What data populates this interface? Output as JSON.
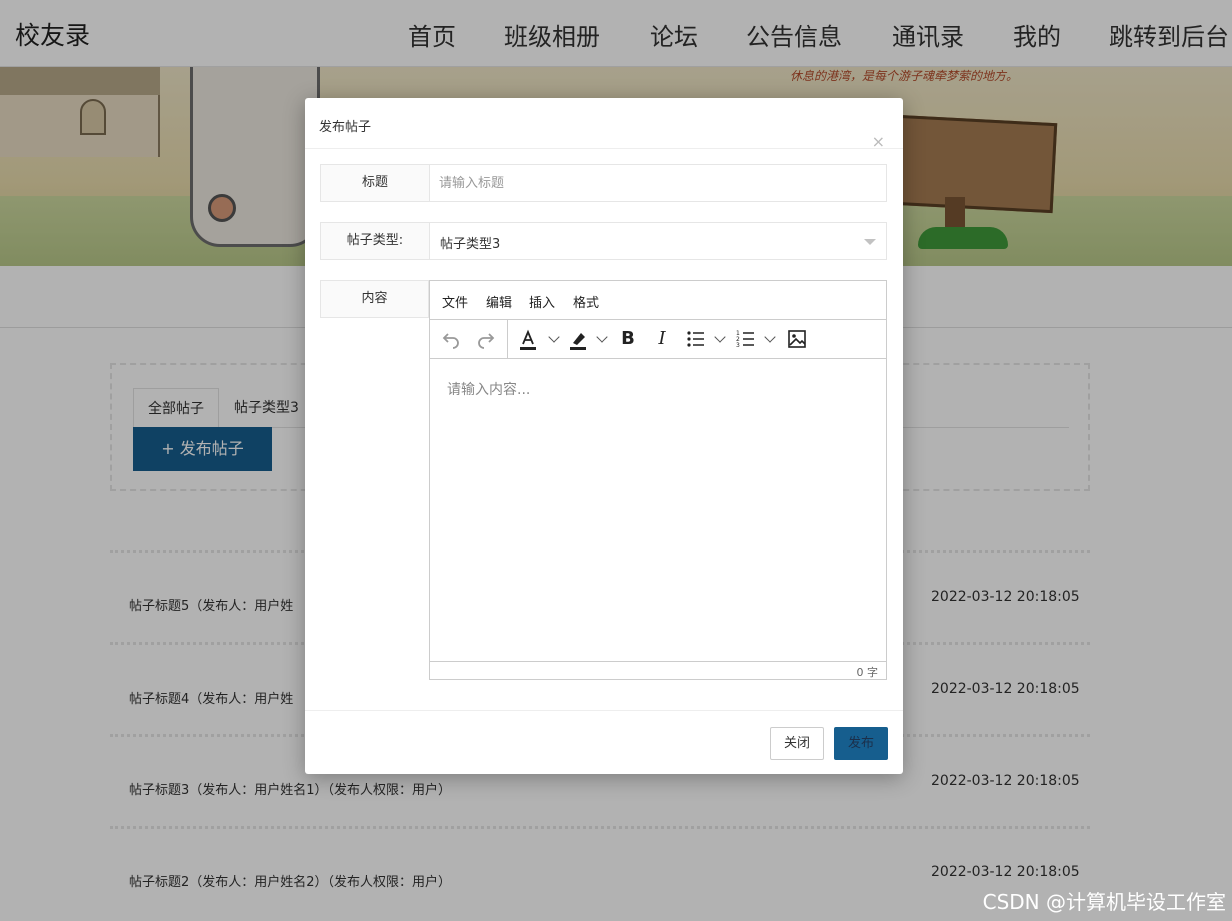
{
  "nav": {
    "brand": "校友录",
    "items": [
      "首页",
      "班级相册",
      "论坛",
      "公告信息",
      "通讯录",
      "我的",
      "跳转到后台"
    ]
  },
  "banner": {
    "slogan": "休息的港湾，是每个游子魂牵梦萦的地方。"
  },
  "forum": {
    "tabs": [
      "全部帖子",
      "帖子类型3"
    ],
    "publish_button": "+ 发布帖子",
    "posts": [
      {
        "title": "帖子标题5（发布人：用户姓",
        "time": "2022-03-12 20:18:05"
      },
      {
        "title": "帖子标题4（发布人：用户姓",
        "time": "2022-03-12 20:18:05"
      },
      {
        "title": "帖子标题3（发布人：用户姓名1）（发布人权限：用户）",
        "time": "2022-03-12 20:18:05"
      },
      {
        "title": "帖子标题2（发布人：用户姓名2）（发布人权限：用户）",
        "time": "2022-03-12 20:18:05"
      }
    ]
  },
  "modal": {
    "title": "发布帖子",
    "close_glyph": "×",
    "fields": {
      "title_label": "标题",
      "title_placeholder": "请输入标题",
      "type_label": "帖子类型:",
      "type_value": "帖子类型3",
      "content_label": "内容"
    },
    "editor": {
      "menus": [
        "文件",
        "编辑",
        "插入",
        "格式"
      ],
      "placeholder": "请输入内容...",
      "word_count": "0 字"
    },
    "buttons": {
      "close": "关闭",
      "submit": "发布"
    }
  },
  "watermark": "CSDN @计算机毕设工作室",
  "colors": {
    "primary": "#165e8e",
    "overlay": "rgba(0,0,0,0.3)"
  }
}
